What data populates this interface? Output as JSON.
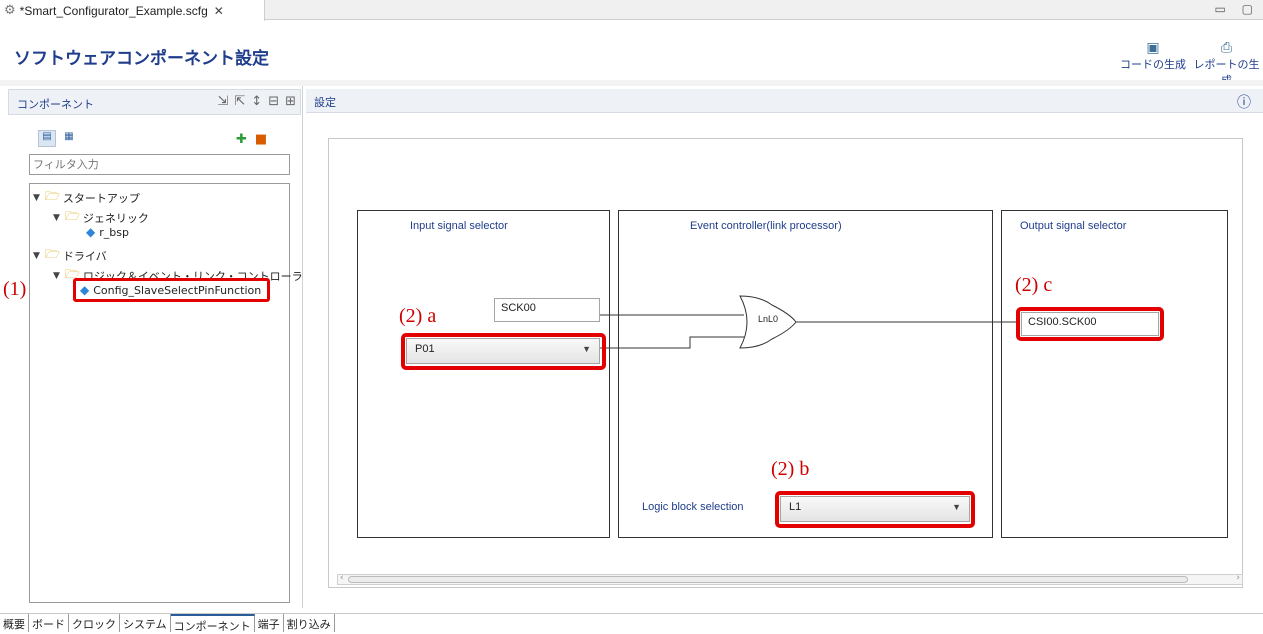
{
  "editor_tab": {
    "title": "*Smart_Configurator_Example.scfg",
    "close": "✕",
    "icon": "gear-icon"
  },
  "window_controls": "▭ ▢",
  "header": {
    "title": "ソフトウェアコンポーネント設定",
    "gen_code": "コードの生成",
    "gen_report": "レポートの生成"
  },
  "left": {
    "title": "コンポーネント",
    "filter_placeholder": "フィルタ入力",
    "tree": [
      {
        "label": "スタートアップ",
        "level": 0,
        "type": "folder"
      },
      {
        "label": "ジェネリック",
        "level": 1,
        "type": "folder"
      },
      {
        "label": "r_bsp",
        "level": 2,
        "type": "component"
      },
      {
        "label": "ドライバ",
        "level": 0,
        "type": "folder"
      },
      {
        "label": "ロジック＆イベント・リンク・コントローラ",
        "level": 1,
        "type": "folder"
      },
      {
        "label": "Config_SlaveSelectPinFunction",
        "level": 2,
        "type": "component",
        "selected": true
      }
    ]
  },
  "right": {
    "title": "設定",
    "input_box_title": "Input signal selector",
    "elc_box_title": "Event controller(link processor)",
    "output_box_title": "Output signal selector",
    "sck_field": "SCK00",
    "pin_combo": "P01",
    "gate_label": "LnL0",
    "output_field": "CSI00.SCK00",
    "logic_label": "Logic block selection",
    "logic_combo": "L1"
  },
  "annotations": {
    "a1": "(1)",
    "a2a": "(2) a",
    "a2b": "(2) b",
    "a2c": "(2) c"
  },
  "bottom_tabs": [
    "概要",
    "ボード",
    "クロック",
    "システム",
    "コンポーネント",
    "端子",
    "割り込み"
  ],
  "colors": {
    "accent": "#1f3d8c",
    "highlight": "#e30000"
  }
}
